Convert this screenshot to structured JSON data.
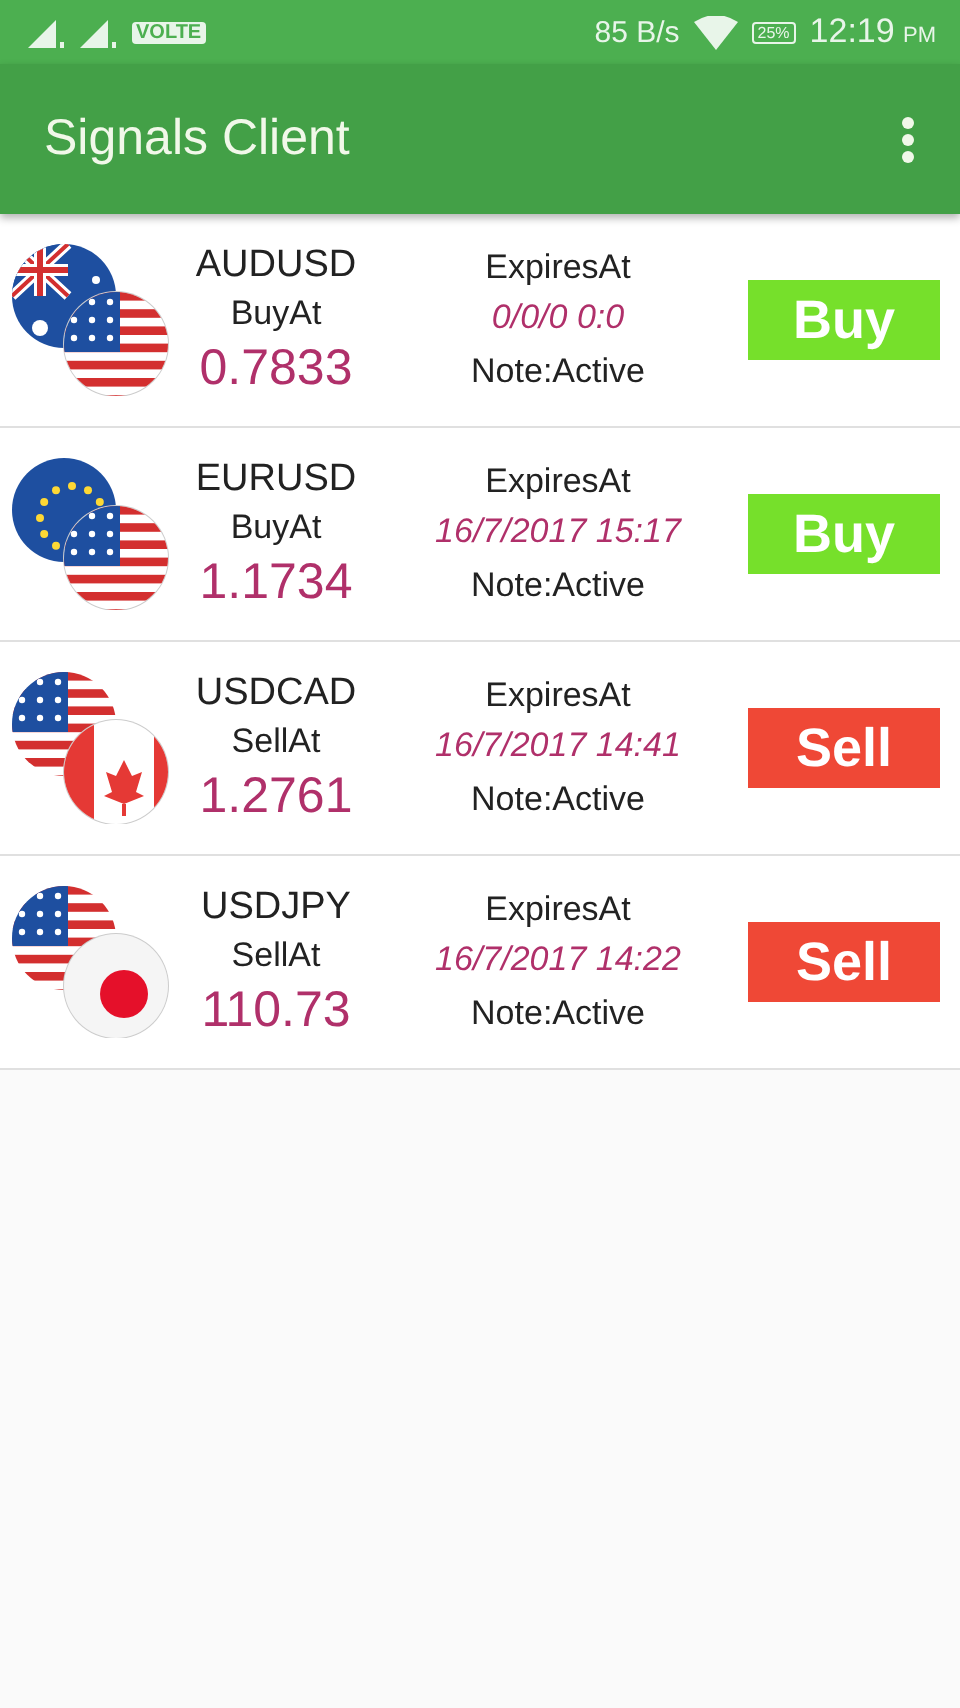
{
  "status_bar": {
    "network": "VOLTE",
    "speed": "85 B/s",
    "battery": "25%",
    "time": "12:19",
    "ampm": "PM"
  },
  "app_bar": {
    "title": "Signals Client"
  },
  "signals": [
    {
      "pair": "AUDUSD",
      "flags": [
        {
          "kind": "au"
        },
        {
          "kind": "us"
        }
      ],
      "price_label": "BuyAt",
      "price": "0.7833",
      "expires_label": "ExpiresAt",
      "expires": "0/0/0 0:0",
      "note": "Note:Active",
      "action": {
        "label": "Buy",
        "kind": "buy"
      }
    },
    {
      "pair": "EURUSD",
      "flags": [
        {
          "kind": "eu"
        },
        {
          "kind": "us"
        }
      ],
      "price_label": "BuyAt",
      "price": "1.1734",
      "expires_label": "ExpiresAt",
      "expires": "16/7/2017 15:17",
      "note": "Note:Active",
      "action": {
        "label": "Buy",
        "kind": "buy"
      }
    },
    {
      "pair": "USDCAD",
      "flags": [
        {
          "kind": "us"
        },
        {
          "kind": "ca"
        }
      ],
      "price_label": "SellAt",
      "price": "1.2761",
      "expires_label": "ExpiresAt",
      "expires": "16/7/2017 14:41",
      "note": "Note:Active",
      "action": {
        "label": "Sell",
        "kind": "sell"
      }
    },
    {
      "pair": "USDJPY",
      "flags": [
        {
          "kind": "us"
        },
        {
          "kind": "jp"
        }
      ],
      "price_label": "SellAt",
      "price": "110.73",
      "expires_label": "ExpiresAt",
      "expires": "16/7/2017 14:22",
      "note": "Note:Active",
      "action": {
        "label": "Sell",
        "kind": "sell"
      }
    }
  ]
}
